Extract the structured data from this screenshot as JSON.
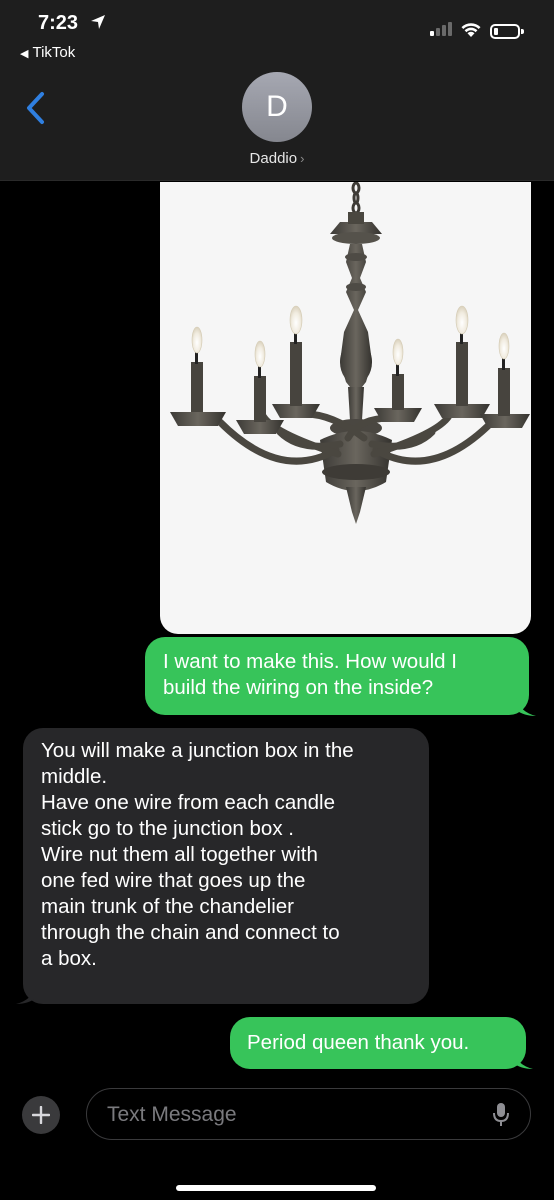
{
  "status_bar": {
    "time": "7:23",
    "back_app": "TikTok",
    "signal_bars": 4,
    "signal_filled": 1,
    "battery_level": 0.15
  },
  "header": {
    "avatar_initial": "D",
    "contact_name": "Daddio",
    "accent_color": "#2f7fe0"
  },
  "messages": [
    {
      "direction": "sent",
      "kind": "image",
      "image_subject": "chandelier"
    },
    {
      "direction": "sent",
      "lines": [
        "I want to make this. How would I",
        "build the wiring on the inside?"
      ]
    },
    {
      "direction": "received",
      "lines": [
        "You will make a junction box in the",
        "middle.",
        "Have one wire from each candle",
        "stick go to the junction box .",
        "Wire nut them all together with",
        "one fed wire that goes up the",
        "main trunk of the chandelier",
        "through the chain and connect to",
        "a box."
      ]
    },
    {
      "direction": "sent",
      "lines": [
        "Period queen thank you."
      ]
    }
  ],
  "composer": {
    "placeholder": "Text Message",
    "value": ""
  },
  "colors": {
    "sent_bubble": "#37c45a",
    "received_bubble": "#272729",
    "background": "#000000"
  }
}
